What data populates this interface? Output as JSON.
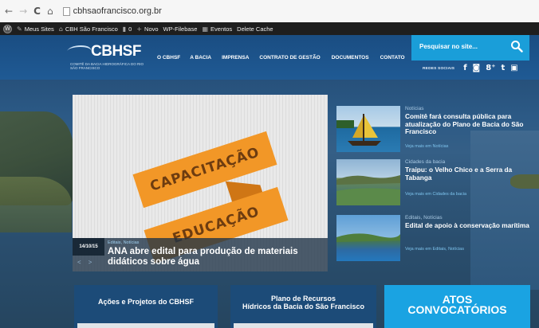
{
  "browser": {
    "url": "cbhsaofrancisco.org.br",
    "back_glyph": "←",
    "forward_glyph": "→",
    "reload_glyph": "C",
    "home_glyph": "⌂"
  },
  "admin_bar": {
    "items": [
      {
        "icon": "wordpress-logo",
        "label": ""
      },
      {
        "icon": "wrench-icon",
        "label": "Meus Sites"
      },
      {
        "icon": "house-icon",
        "label": "CBH São Francisco"
      },
      {
        "icon": "comment-icon",
        "label": "0"
      },
      {
        "icon": "plus-icon",
        "label": "Novo"
      },
      {
        "icon": "",
        "label": "WP-Filebase"
      },
      {
        "icon": "calendar-icon",
        "label": "Eventos"
      },
      {
        "icon": "",
        "label": "Delete Cache"
      }
    ]
  },
  "header": {
    "logo_text": "CBHSF",
    "logo_sub": "COMITÊ DA BACIA HIDROGRÁFICA DO RIO SÃO FRANCISCO",
    "nav": [
      "O CBHSF",
      "A BACIA",
      "IMPRENSA",
      "CONTRATO DE GESTÃO",
      "DOCUMENTOS",
      "CONTATO"
    ],
    "search_placeholder": "Pesquisar no site...",
    "social_label": "REDES SOCIAIS",
    "social_icons": [
      "f",
      "◙",
      "8⁺",
      "t",
      "▣"
    ],
    "colors": {
      "header": "#1f5a94",
      "search": "#1a9ed9"
    }
  },
  "hero": {
    "ribbon_top": "CAPACITAÇÃO",
    "ribbon_bottom": "EDUCAÇÃO",
    "date": "14/10/15",
    "categories": "Editais, Notícias",
    "title": "ANA abre edital para produção de materiais didáticos sobre água",
    "prev": "<",
    "next": ">",
    "accent": "#f29727"
  },
  "news": [
    {
      "category": "Notícias",
      "title": "Comitê fará consulta pública para atualização do Plano de Bacia do São Francisco",
      "more": "Veja mais em Notícias"
    },
    {
      "category": "Cidades da bacia",
      "title": "Traipu: o Velho Chico e a Serra da Tabanga",
      "more": "Veja mais em Cidades da bacia"
    },
    {
      "category": "Editais, Notícias",
      "title": "Edital de apoio à conservação marítima",
      "more": "Veja mais em Editais, Notícias"
    }
  ],
  "bottom": {
    "box1": "Ações e Projetos do CBHSF",
    "box2_line1": "Plano de Recursos",
    "box2_line2": "Hídricos da Bacia do São Francisco",
    "box3_line1": "ATOS",
    "box3_line2": "CONVOCATÓRIOS",
    "accent": "#1aa3e2"
  }
}
